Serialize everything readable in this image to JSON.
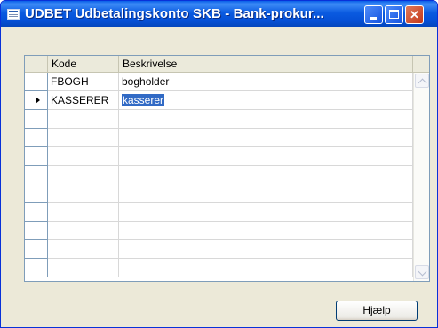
{
  "window": {
    "title": "UDBET Udbetalingskonto SKB - Bank-prokur...",
    "controls": [
      "minimize",
      "maximize",
      "close"
    ]
  },
  "grid": {
    "columns": [
      "Kode",
      "Beskrivelse"
    ],
    "rows": [
      {
        "code": "FBOGH",
        "description": "bogholder",
        "current": false
      },
      {
        "code": "KASSERER",
        "description": "kasserer",
        "current": true,
        "description_selected": true
      }
    ],
    "empty_row_count": 9
  },
  "buttons": {
    "help": "Hjælp"
  },
  "colors": {
    "title_blue": "#0550d6",
    "selection": "#316ac5",
    "close_red": "#c4381a"
  }
}
